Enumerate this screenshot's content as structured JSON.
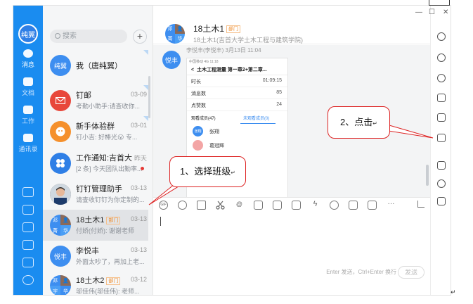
{
  "rail": {
    "user_avatar": "纯翼",
    "items": [
      {
        "label": "消息"
      },
      {
        "label": "文档"
      },
      {
        "label": "工作"
      },
      {
        "label": "通讯录"
      }
    ]
  },
  "list": {
    "search_placeholder": "搜索",
    "add_symbol": "+",
    "conversations": [
      {
        "avatar": "纯翼",
        "name": "我（唐纯翼）",
        "time": "",
        "preview": ""
      },
      {
        "avatar": "",
        "name": "钉邮",
        "time": "03-09",
        "preview": "考勤小助手:请查收你..."
      },
      {
        "avatar": "",
        "name": "新手体验群",
        "time": "03-01",
        "preview": "钉小吉: 好棒光😮 专..."
      },
      {
        "avatar": "",
        "name": "工作通知:吉首大...",
        "time": "昨天",
        "preview": "[2 条] 今天团队出勤率..."
      },
      {
        "avatar": "",
        "name": "钉钉管理助手",
        "time": "03-13",
        "preview": "请查收钉钉为你定制的..."
      },
      {
        "avatar": "",
        "name": "18土木1",
        "tag": "部门",
        "time": "03-13",
        "preview": "付娇(付娇): 谢谢老师"
      },
      {
        "avatar": "悦丰",
        "name": "李悦丰",
        "time": "03-13",
        "preview": "外面太吵了，再加上老..."
      },
      {
        "avatar": "",
        "name": "18土木2",
        "tag": "部门",
        "time": "03-12",
        "preview": "邬佳伟(邬佳伟): 老师..."
      }
    ]
  },
  "chat": {
    "title": "18土木1",
    "tag": "部门",
    "subtitle": "18土木1(吉首大学土木工程与建筑学院)",
    "message": {
      "avatar": "悦丰",
      "sender": "李悦丰(李悦丰)   3月13日 11:04",
      "phone": {
        "status": "中国移动 4G        11:18",
        "title": "土木工程测量 第一章2+第二章...",
        "rows": [
          {
            "label": "时长",
            "value": "01:09:15"
          },
          {
            "label": "消息数",
            "value": "85"
          },
          {
            "label": "点赞数",
            "value": "24"
          }
        ],
        "tab1": "观看成员(47)",
        "tab2": "未观看成员(0)",
        "students": [
          {
            "avatar": "张翔",
            "name": "张翔"
          },
          {
            "avatar": "",
            "name": "葛冠辉"
          }
        ]
      }
    },
    "input_hint": "Enter 发送，Ctrl+Enter 换行",
    "send_label": "发送"
  },
  "window": {
    "minimize": "—",
    "maximize": "☐",
    "close": "✕"
  },
  "callouts": {
    "step1": "1、选择班级",
    "step2": "2、点击",
    "return_mark": "↵"
  },
  "colors": {
    "accent": "#1a8cf0",
    "callout_border": "#dd2222"
  }
}
